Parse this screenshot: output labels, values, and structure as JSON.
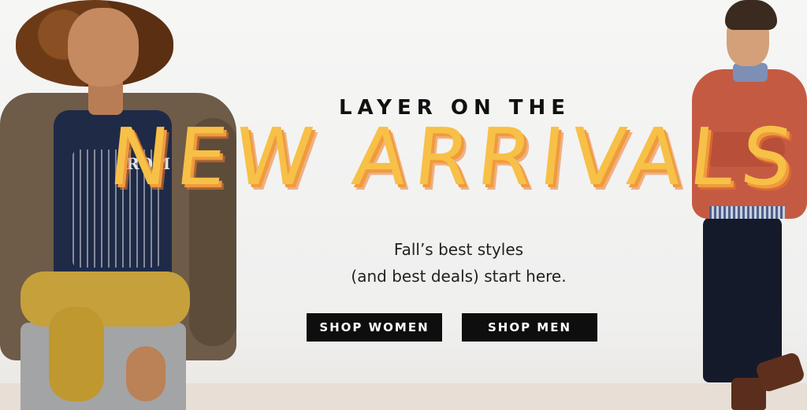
{
  "banner": {
    "kicker": "LAYER ON THE",
    "headline": "NEW ARRIVALS",
    "subline_1": "Fall’s best styles",
    "subline_2": "(and best deals) start here.",
    "buttons": {
      "shop_women": "SHOP WOMEN",
      "shop_men": "SHOP MEN"
    },
    "shirt_print_text": "ROM"
  },
  "colors": {
    "headline": "#f7c047",
    "headline_shadow": "#ef9b3d",
    "button_bg": "#0e0e0e",
    "button_text": "#ffffff",
    "text": "#111111"
  }
}
